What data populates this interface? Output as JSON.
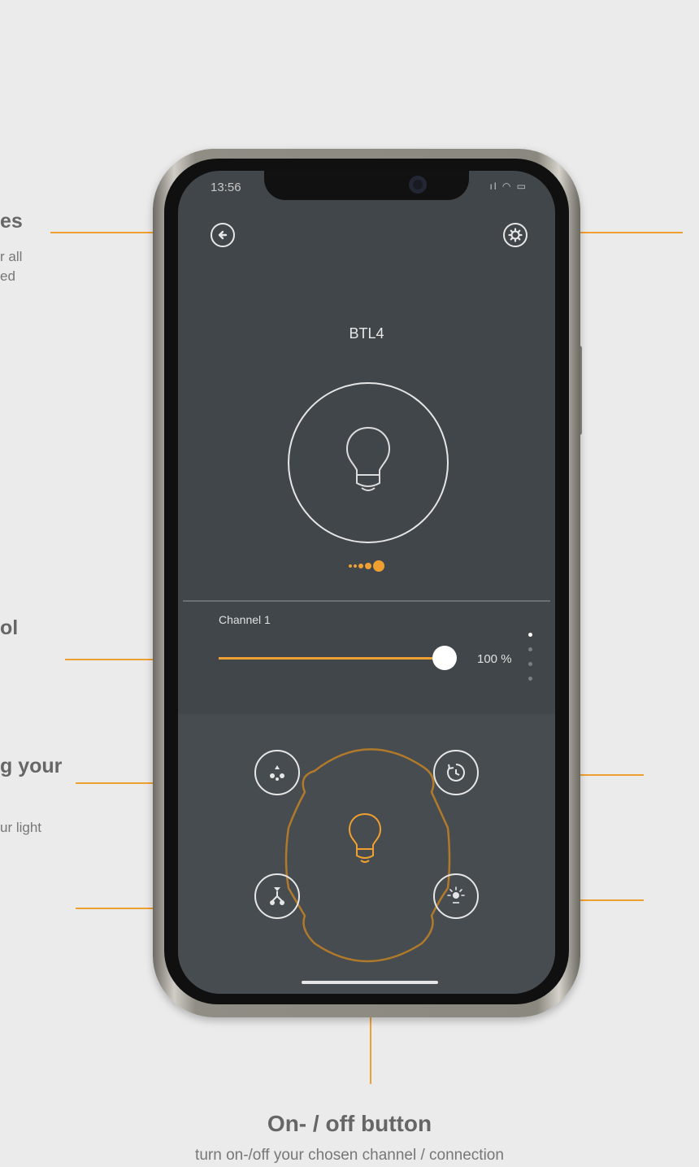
{
  "app": {
    "status_time": "13:56",
    "status_icons": "ıl ◠ ▭",
    "device_name": "BTL4",
    "channel_label": "Channel 1",
    "slider_value": "100 %",
    "slider_level_percent": 100,
    "accent_color": "#f0a030",
    "icons": {
      "back": "back-arrow-icon",
      "settings": "gear-icon",
      "bulb": "light-bulb-icon",
      "scene": "scene-icon",
      "timer": "timer-icon",
      "group": "group-icon",
      "brightness": "brightness-icon"
    }
  },
  "callouts": {
    "left_top_title": "es",
    "left_top_desc_1": "r all",
    "left_top_desc_2": "ed",
    "left_mid_title": "ol",
    "left_lower_title": "g your",
    "left_lower_desc": "ur light",
    "bottom_title": "On- / off button",
    "bottom_desc": "turn on-/off your chosen channel / connection"
  }
}
